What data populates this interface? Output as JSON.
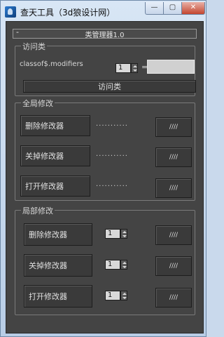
{
  "window": {
    "title": "查天工具（3d狼设计网）",
    "buttons": {
      "minimize": "—",
      "maximize": "▢",
      "close": "✕"
    }
  },
  "rollout": {
    "toggle": "-",
    "title": "类管理器1.0"
  },
  "access": {
    "label": "访问类",
    "expression": "classof$.modifiers",
    "spinner_value": "1",
    "equals": "=",
    "field_value": "",
    "button": "访问类"
  },
  "global": {
    "label": "全局修改",
    "rows": [
      {
        "button": "删除修改器",
        "dots": "...........",
        "action": "////"
      },
      {
        "button": "关掉修改器",
        "dots": "...........",
        "action": "////"
      },
      {
        "button": "打开修改器",
        "dots": "...........",
        "action": "////"
      }
    ]
  },
  "local": {
    "label": "局部修改",
    "rows": [
      {
        "button": "删除修改器",
        "spinner_value": "1",
        "action": "////"
      },
      {
        "button": "关掉修改器",
        "spinner_value": "1",
        "action": "////"
      },
      {
        "button": "打开修改器",
        "spinner_value": "1",
        "action": "////"
      }
    ]
  }
}
